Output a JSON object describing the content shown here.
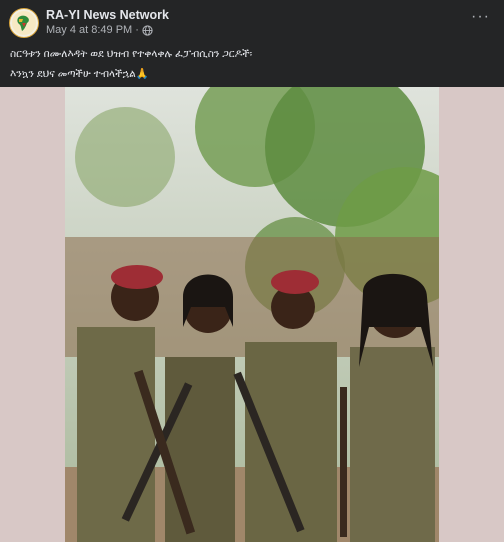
{
  "post": {
    "page_name": "RA-YI News Network",
    "timestamp": "May 4 at 8:49 PM",
    "separator": "·",
    "privacy_icon": "globe-icon",
    "more_icon": "more-options-icon",
    "more_label": "···",
    "caption_lines": [
      "ስርዓቱን በሙለእዳት ወደ ህዝብ የተቀላቀሉ ፈፓብሲስን ጋርዶች፡",
      "እንኳን ደህና መጣችሁ ተብላችኋል🙏"
    ]
  },
  "colors": {
    "background": "#242526",
    "text_primary": "#e4e6eb",
    "text_secondary": "#b0b3b8",
    "media_backdrop": "#d8c8c6"
  }
}
